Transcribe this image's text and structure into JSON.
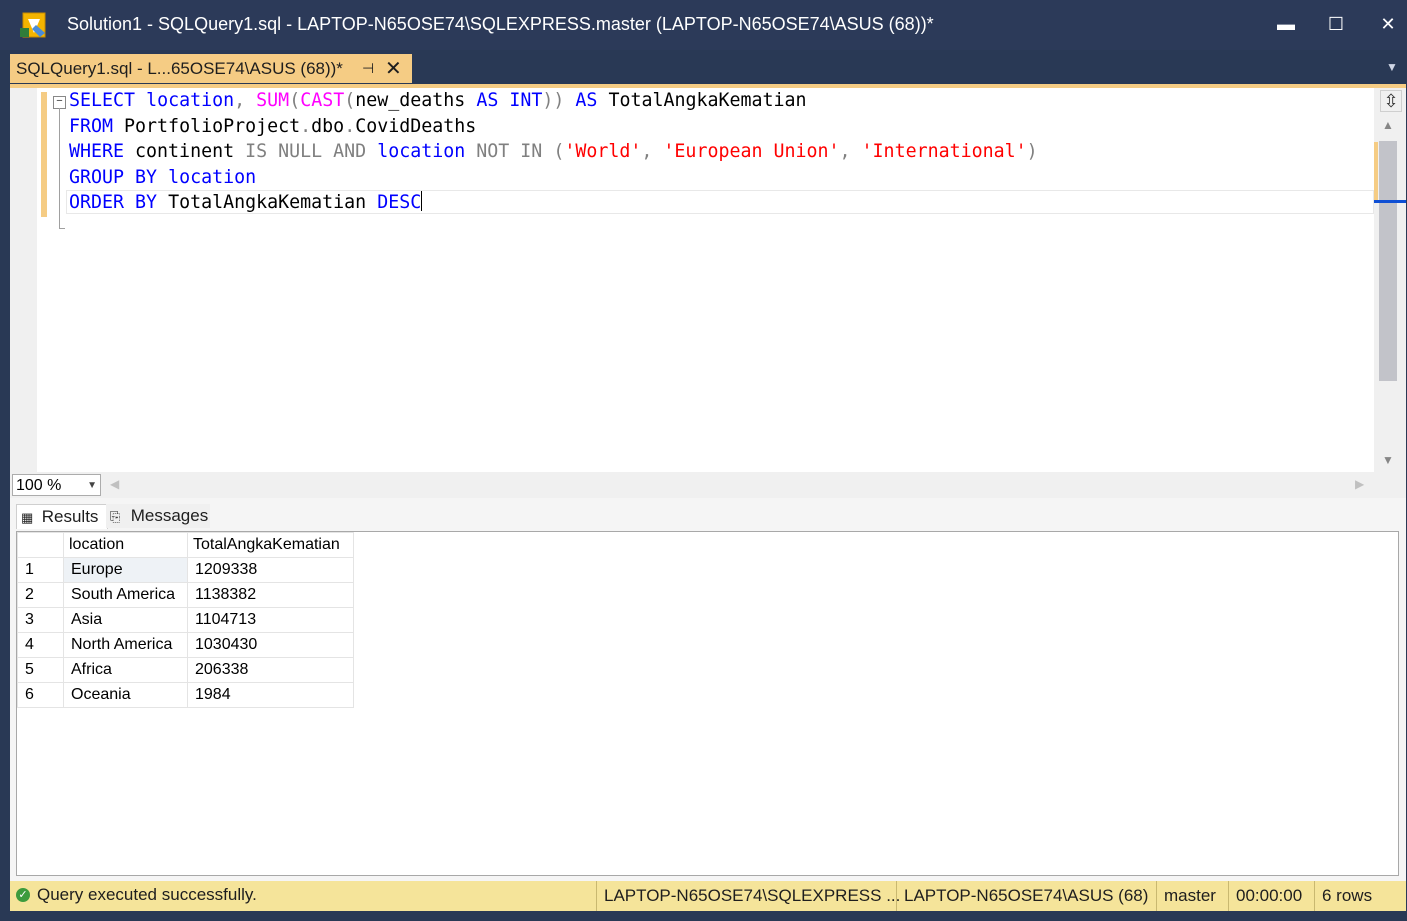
{
  "window": {
    "title": "Solution1 - SQLQuery1.sql - LAPTOP-N65OSE74\\SQLEXPRESS.master (LAPTOP-N65OSE74\\ASUS (68))*",
    "minimize": "▬",
    "maximize": "☐",
    "close": "✕"
  },
  "doc_tab": {
    "label": "SQLQuery1.sql - L...65OSE74\\ASUS (68))*",
    "pin": "⊣",
    "close": "✕",
    "dropdown": "▼"
  },
  "editor": {
    "collapse": "−",
    "lines": [
      [
        {
          "t": "SELECT",
          "c": "kw"
        },
        {
          "t": " "
        },
        {
          "t": "location",
          "c": "kw"
        },
        {
          "t": ",",
          "c": "gray"
        },
        {
          "t": " "
        },
        {
          "t": "SUM",
          "c": "fn"
        },
        {
          "t": "(",
          "c": "gray"
        },
        {
          "t": "CAST",
          "c": "fn"
        },
        {
          "t": "(",
          "c": "gray"
        },
        {
          "t": "new_deaths "
        },
        {
          "t": "AS",
          "c": "kw"
        },
        {
          "t": " "
        },
        {
          "t": "INT",
          "c": "kw"
        },
        {
          "t": "))",
          "c": "gray"
        },
        {
          "t": " "
        },
        {
          "t": "AS",
          "c": "kw"
        },
        {
          "t": " TotalAngkaKematian"
        }
      ],
      [
        {
          "t": "FROM",
          "c": "kw"
        },
        {
          "t": " PortfolioProject"
        },
        {
          "t": ".",
          "c": "gray"
        },
        {
          "t": "dbo"
        },
        {
          "t": ".",
          "c": "gray"
        },
        {
          "t": "CovidDeaths"
        }
      ],
      [
        {
          "t": "WHERE",
          "c": "kw"
        },
        {
          "t": " continent "
        },
        {
          "t": "IS NULL AND",
          "c": "gray"
        },
        {
          "t": " "
        },
        {
          "t": "location",
          "c": "kw"
        },
        {
          "t": " "
        },
        {
          "t": "NOT IN",
          "c": "gray"
        },
        {
          "t": " ",
          "c": "gray"
        },
        {
          "t": "(",
          "c": "gray"
        },
        {
          "t": "'World'",
          "c": "str"
        },
        {
          "t": ", ",
          "c": "gray"
        },
        {
          "t": "'European Union'",
          "c": "str"
        },
        {
          "t": ", ",
          "c": "gray"
        },
        {
          "t": "'International'",
          "c": "str"
        },
        {
          "t": ")",
          "c": "gray"
        }
      ],
      [
        {
          "t": "GROUP BY",
          "c": "kw"
        },
        {
          "t": " "
        },
        {
          "t": "location",
          "c": "kw"
        }
      ],
      [
        {
          "t": "ORDER BY",
          "c": "kw"
        },
        {
          "t": " TotalAngkaKematian "
        },
        {
          "t": "DESC",
          "c": "kw"
        }
      ]
    ],
    "split": "⇳",
    "scroll_up": "▲",
    "scroll_down": "▼"
  },
  "zoom": {
    "value": "100 %",
    "arrow": "▼",
    "left": "◀",
    "right": "▶"
  },
  "results": {
    "tabs": [
      {
        "icon": "▦",
        "label": "Results"
      },
      {
        "icon": "⎘",
        "label": "Messages"
      }
    ],
    "columns": [
      "",
      "location",
      "TotalAngkaKematian"
    ],
    "rows": [
      [
        "1",
        "Europe",
        "1209338"
      ],
      [
        "2",
        "South America",
        "1138382"
      ],
      [
        "3",
        "Asia",
        "1104713"
      ],
      [
        "4",
        "North America",
        "1030430"
      ],
      [
        "5",
        "Africa",
        "206338"
      ],
      [
        "6",
        "Oceania",
        "1984"
      ]
    ]
  },
  "status": {
    "icon": "✓",
    "message": "Query executed successfully.",
    "server": "LAPTOP-N65OSE74\\SQLEXPRESS ...",
    "user": "LAPTOP-N65OSE74\\ASUS (68)",
    "database": "master",
    "elapsed": "00:00:00",
    "rows": "6 rows"
  },
  "colors": {
    "accent_tab": "#f5cc84",
    "status_bar": "#f5e49a",
    "titlebar": "#2c3a59",
    "keyword": "#0000ff",
    "function": "#ff00ff",
    "string": "#ff0000",
    "operator": "#808080"
  }
}
